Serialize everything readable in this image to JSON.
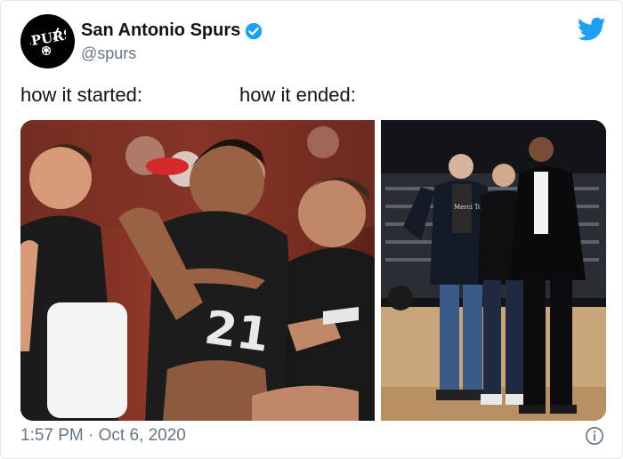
{
  "account": {
    "display_name": "San Antonio Spurs",
    "handle": "@spurs",
    "verified": true,
    "avatar_icon": "spurs-logo-icon"
  },
  "tweet": {
    "text_left": "how it started:",
    "text_right": "how it ended:",
    "timestamp": "1:57 PM · Oct 6, 2020"
  },
  "media": {
    "left_photo_jersey_number": "21",
    "right_photo_shirt_text": "Merci Tony"
  },
  "icons": {
    "brand": "twitter-bird-icon",
    "verified": "verified-badge-icon",
    "info": "info-icon"
  },
  "colors": {
    "twitter_blue": "#1da1f2",
    "muted_text": "#657786"
  }
}
